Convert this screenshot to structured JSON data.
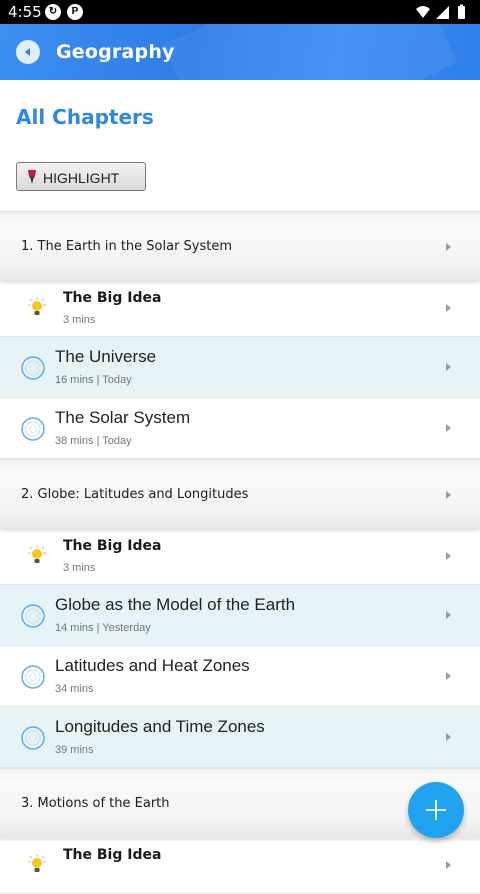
{
  "status_bar": {
    "time": "4:55",
    "left_icons": [
      "sync-icon",
      "app-notification-icon"
    ],
    "right_icons": [
      "wifi-icon",
      "signal-icon",
      "battery-icon"
    ]
  },
  "app_bar": {
    "title": "Geography",
    "back_icon": "back-arrow-icon",
    "color": "#2f80ea"
  },
  "page": {
    "section_title": "All Chapters",
    "highlight_button": "HIGHLIGHT",
    "highlight_icon": "highlighter-pen-icon",
    "accent": "#2f86e6",
    "tint_row_color": "#e7f4f7"
  },
  "chapters": [
    {
      "title": "1. The Earth in the Solar System",
      "items": [
        {
          "kind": "big-idea",
          "title": "The Big Idea",
          "meta": "3 mins"
        },
        {
          "kind": "topic",
          "title": "The Universe",
          "meta": "16 mins | Today",
          "tinted": true
        },
        {
          "kind": "topic",
          "title": "The Solar System",
          "meta": "38 mins | Today",
          "tinted": false
        }
      ]
    },
    {
      "title": "2. Globe: Latitudes and Longitudes",
      "items": [
        {
          "kind": "big-idea",
          "title": "The Big Idea",
          "meta": "3 mins"
        },
        {
          "kind": "topic",
          "title": "Globe as the Model of the Earth",
          "meta": "14 mins | Yesterday",
          "tinted": true
        },
        {
          "kind": "topic",
          "title": "Latitudes and Heat Zones",
          "meta": "34 mins",
          "tinted": false
        },
        {
          "kind": "topic",
          "title": "Longitudes and Time Zones",
          "meta": "39 mins",
          "tinted": true
        }
      ]
    },
    {
      "title": "3. Motions of the Earth",
      "items": [
        {
          "kind": "big-idea",
          "title": "The Big Idea",
          "meta": ""
        }
      ]
    }
  ],
  "fab": {
    "icon": "plus-icon",
    "color": "#1fa3ee"
  }
}
